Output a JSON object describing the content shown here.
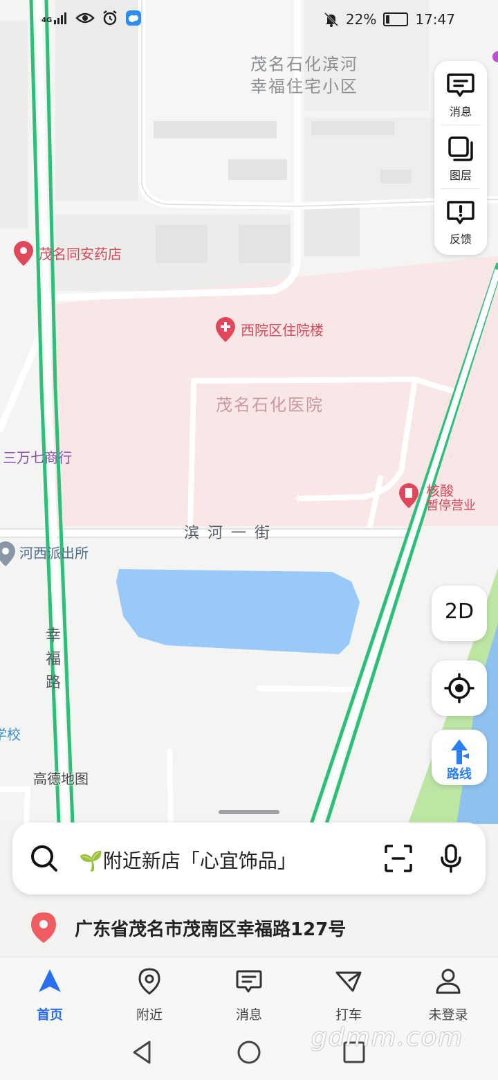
{
  "status_bar": {
    "signal_text": "4G",
    "battery_percent": "22%",
    "time": "17:47",
    "battery_level": 0.22,
    "icons": [
      "signal-icon",
      "eye-icon",
      "alarm-icon",
      "weather-app-icon",
      "mute-icon",
      "battery-icon"
    ]
  },
  "map": {
    "labels": {
      "residential_line1": "茂名石化滨河",
      "residential_line2": "幸福住宅小区",
      "pharmacy": "茂名同安药店",
      "inpatient": "西院区住院楼",
      "hospital": "茂名石化医院",
      "shop": "三万七商行",
      "nucleic_title": "核酸",
      "nucleic_status": "暂停营业",
      "street": "滨河一街",
      "police": "河西派出所",
      "road_vertical": "幸福路",
      "school": "学校",
      "provider": "高德地图"
    },
    "colors": {
      "hospital_area": "#f9e6e6",
      "water": "#98c9f8",
      "route": "#2bc07a",
      "park": "#bde5a4",
      "pin_red": "#e0475b"
    }
  },
  "side_panel": {
    "items": [
      {
        "label": "消息",
        "icon": "message-icon"
      },
      {
        "label": "图层",
        "icon": "layers-icon"
      },
      {
        "label": "反馈",
        "icon": "feedback-icon"
      }
    ]
  },
  "controls": {
    "mode_label": "2D",
    "locate_icon": "locate-icon",
    "route_label": "路线"
  },
  "search": {
    "text": "🌱附近新店「心宜饰品」",
    "icons": [
      "search-icon",
      "scan-icon",
      "microphone-icon"
    ]
  },
  "address": {
    "text": "广东省茂名市茂南区幸福路127号"
  },
  "tabs": [
    {
      "label": "首页",
      "icon": "home-navigation-icon",
      "active": true
    },
    {
      "label": "附近",
      "icon": "location-pin-icon",
      "active": false
    },
    {
      "label": "消息",
      "icon": "message-icon",
      "active": false
    },
    {
      "label": "打车",
      "icon": "taxi-icon",
      "active": false
    },
    {
      "label": "未登录",
      "icon": "user-icon",
      "active": false
    }
  ],
  "watermark": "gdmm.com"
}
